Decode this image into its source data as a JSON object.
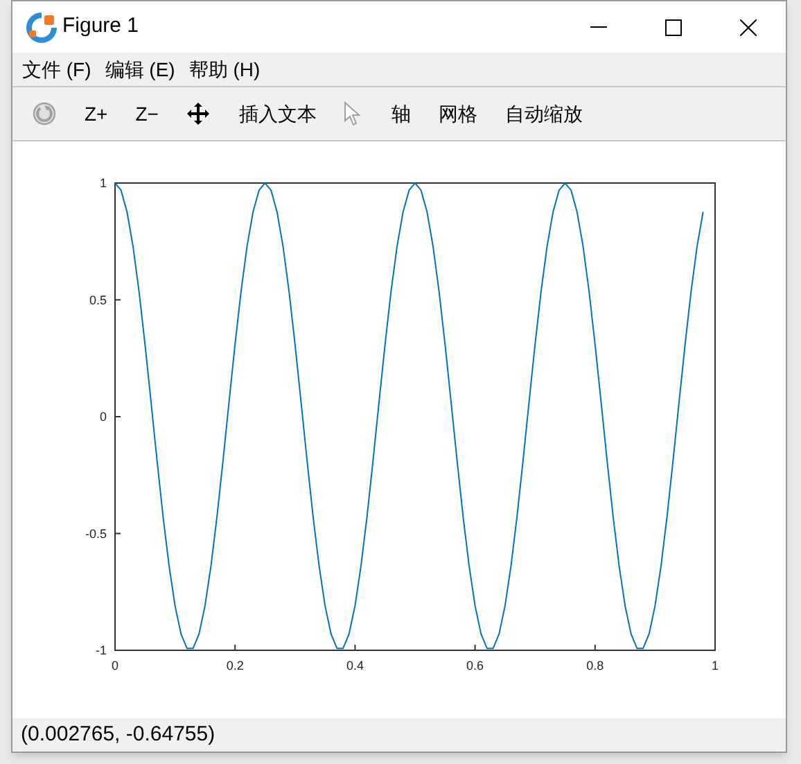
{
  "window": {
    "title": "Figure 1"
  },
  "menu": [
    {
      "label": "文件 (F)"
    },
    {
      "label": "编辑 (E)"
    },
    {
      "label": "帮助 (H)"
    }
  ],
  "toolbar": [
    {
      "kind": "rotate",
      "disabled": true
    },
    {
      "kind": "text",
      "label": "Z+",
      "disabled": false
    },
    {
      "kind": "text",
      "label": "Z−",
      "disabled": false
    },
    {
      "kind": "pan",
      "disabled": false
    },
    {
      "kind": "text",
      "label": "插入文本",
      "disabled": false
    },
    {
      "kind": "pointer",
      "disabled": true
    },
    {
      "kind": "text",
      "label": "轴",
      "disabled": false
    },
    {
      "kind": "text",
      "label": "网格",
      "disabled": false
    },
    {
      "kind": "text",
      "label": "自动缩放",
      "disabled": false
    }
  ],
  "plot": {
    "chart_data": {
      "type": "line",
      "xlim": [
        0,
        1
      ],
      "ylim": [
        -1,
        1
      ],
      "xticks": [
        {
          "value": 0,
          "label": "0"
        },
        {
          "value": 0.2,
          "label": "0.2"
        },
        {
          "value": 0.4,
          "label": "0.4"
        },
        {
          "value": 0.6,
          "label": "0.6"
        },
        {
          "value": 0.8,
          "label": "0.8"
        },
        {
          "value": 1,
          "label": "1"
        }
      ],
      "yticks": [
        {
          "value": -1,
          "label": "-1"
        },
        {
          "value": -0.5,
          "label": "-0.5"
        },
        {
          "value": 0,
          "label": "0"
        },
        {
          "value": 0.5,
          "label": "0.5"
        },
        {
          "value": 1,
          "label": "1"
        }
      ],
      "x": [
        0,
        0.01,
        0.02,
        0.03,
        0.04,
        0.05,
        0.06,
        0.07,
        0.08,
        0.09,
        0.1,
        0.11,
        0.12,
        0.13,
        0.14,
        0.15,
        0.16,
        0.17,
        0.18,
        0.19,
        0.2,
        0.21,
        0.22,
        0.23,
        0.24,
        0.25,
        0.26,
        0.27,
        0.28,
        0.29,
        0.3,
        0.31,
        0.32,
        0.33,
        0.34,
        0.35,
        0.36,
        0.37,
        0.38,
        0.39,
        0.4,
        0.41,
        0.42,
        0.43,
        0.44,
        0.45,
        0.46,
        0.47,
        0.48,
        0.49,
        0.5,
        0.51,
        0.52,
        0.53,
        0.54,
        0.55,
        0.56,
        0.57,
        0.58,
        0.59,
        0.6,
        0.61,
        0.62,
        0.63,
        0.64,
        0.65,
        0.66,
        0.67,
        0.68,
        0.69,
        0.7,
        0.71,
        0.72,
        0.73,
        0.74,
        0.75,
        0.76,
        0.77,
        0.78,
        0.79,
        0.8,
        0.81,
        0.82,
        0.83,
        0.84,
        0.85,
        0.86,
        0.87,
        0.88,
        0.89,
        0.9,
        0.91,
        0.92,
        0.93,
        0.94,
        0.95,
        0.96,
        0.97,
        0.98
      ],
      "series": [
        {
          "color": "#0072bd",
          "values": [
            1,
            0.969,
            0.876,
            0.729,
            0.536,
            0.309,
            0.063,
            -0.187,
            -0.426,
            -0.637,
            -0.809,
            -0.93,
            -0.992,
            -0.992,
            -0.93,
            -0.809,
            -0.637,
            -0.426,
            -0.187,
            0.063,
            0.309,
            0.536,
            0.729,
            0.876,
            0.969,
            1,
            0.969,
            0.876,
            0.729,
            0.536,
            0.309,
            0.063,
            -0.187,
            -0.426,
            -0.637,
            -0.809,
            -0.93,
            -0.992,
            -0.992,
            -0.93,
            -0.809,
            -0.637,
            -0.426,
            -0.187,
            0.063,
            0.309,
            0.536,
            0.729,
            0.876,
            0.969,
            1,
            0.969,
            0.876,
            0.729,
            0.536,
            0.309,
            0.063,
            -0.187,
            -0.426,
            -0.637,
            -0.809,
            -0.93,
            -0.992,
            -0.992,
            -0.93,
            -0.809,
            -0.637,
            -0.426,
            -0.187,
            0.063,
            0.309,
            0.536,
            0.729,
            0.876,
            0.969,
            1,
            0.969,
            0.876,
            0.729,
            0.536,
            0.309,
            0.063,
            -0.187,
            -0.426,
            -0.637,
            -0.809,
            -0.93,
            -0.992,
            -0.992,
            -0.93,
            -0.809,
            -0.637,
            -0.426,
            -0.187,
            0.063,
            0.309,
            0.536,
            0.729,
            0.876
          ]
        }
      ]
    }
  },
  "status_bar": {
    "text": "(0.002765, -0.64755)"
  }
}
